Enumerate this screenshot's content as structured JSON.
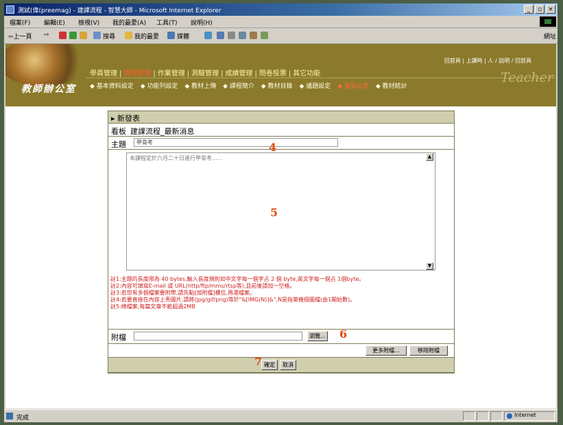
{
  "window": {
    "title": "測試(偉(preemag) - 建課流程 - 智慧大師 - Microsoft Internet Explorer",
    "controls": [
      "_",
      "▫",
      "×"
    ]
  },
  "menu": [
    "檔案(F)",
    "編輯(E)",
    "檢視(V)",
    "我的最愛(A)",
    "工具(T)",
    "說明(H)"
  ],
  "toolbar": {
    "back": "⇦上一頁",
    "forward": "⇨",
    "search": "搜尋",
    "favorites": "我的最愛",
    "media": "媒體",
    "address": "網址"
  },
  "banner": {
    "userbar": "回首頁 | 上課時 | 人 / 說明 / 回首頁",
    "logo": "教師辦公室",
    "teacher": "Teacher",
    "top_nav": [
      "學員管理",
      "課程管理",
      "作業管理",
      "測驗管理",
      "成績管理",
      "問卷投票",
      "其它功能"
    ],
    "top_nav_active": "課程管理",
    "sub_nav": [
      "基本資料設定",
      "功能列設定",
      "教材上傳",
      "課程簡介",
      "教材目錄",
      "議題設定",
      "張貼公告",
      "教材統計"
    ],
    "sub_nav_active": "張貼公告"
  },
  "form": {
    "header": "新發表",
    "board_label": "看板",
    "board_value": "建課流程_最新消息",
    "subject_label": "主題",
    "subject_value": "甲骨考",
    "body_text": "本課程定於六月二十日進行甲骨考......",
    "notes": [
      "註1:主題的長度限為 40 bytes,輸入長度規則如中文字每一個字占 2 個 byte,英文字每一個占 1個byte。",
      "註2:內容可填寫E-mail 或 URL(http/ftp/mms/rtsp等),且前後請加一空格。",
      "註3:若您有多個檔案要附帶,請先點[加附檔]欄位,再選檔案。",
      "註4:若要直接在內容上秀圖片,請將(jpg/gif/png)等於\"&[IMG(N)]&\",N是指第幾個圖檔(由1開始數)。",
      "註5:總檔案,每篇文章不能超過2MB"
    ],
    "attach_label": "附檔",
    "browse_button": "瀏覽...",
    "more_attach_button": "更多附檔...",
    "remove_attach_button": "移除附檔",
    "ok_button": "確定",
    "cancel_button": "取消"
  },
  "annotations": {
    "subject": "4",
    "body": "5",
    "browse": "6",
    "submit": "7"
  },
  "status": {
    "text": "完成",
    "zone": "Internet"
  }
}
